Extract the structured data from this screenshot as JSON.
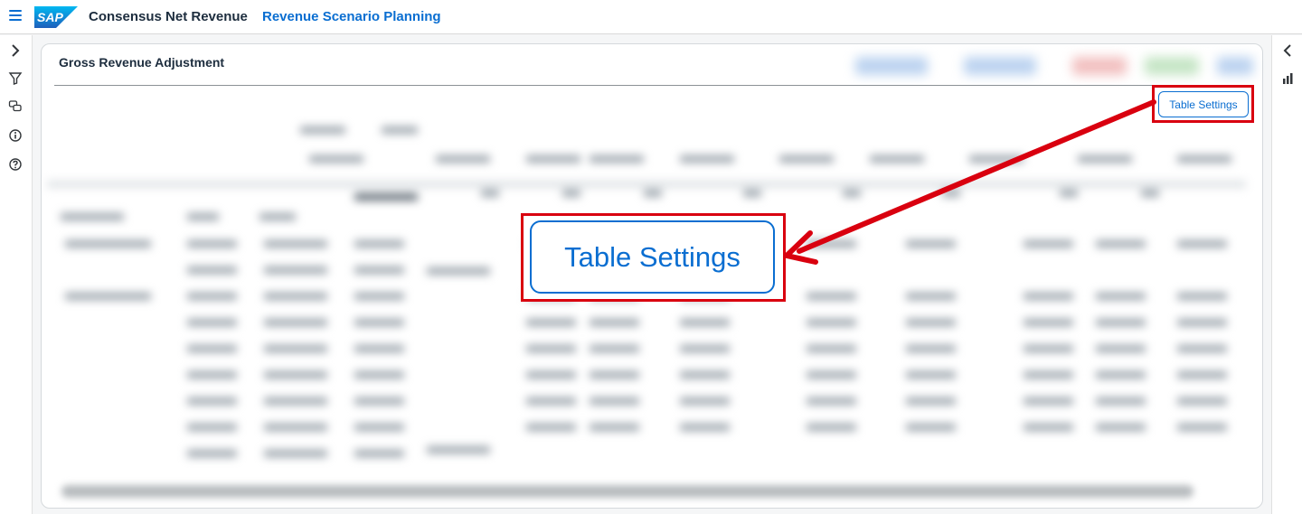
{
  "shellbar": {
    "logo_text": "SAP",
    "title": "Consensus Net Revenue",
    "subtitle": "Revenue Scenario Planning"
  },
  "card": {
    "title": "Gross Revenue Adjustment",
    "table_settings_label": "Table Settings"
  },
  "callout": {
    "label": "Table Settings"
  },
  "icons": {
    "menu": "hamburger-menu-icon",
    "expand": "chevron-right-icon",
    "filter": "filter-icon",
    "comments": "comments-icon",
    "info": "info-icon",
    "help": "help-icon",
    "collapse": "chevron-left-icon",
    "chart": "bar-chart-icon"
  },
  "colors": {
    "brand_blue": "#0a6ed1",
    "highlight_red": "#d9000f"
  }
}
